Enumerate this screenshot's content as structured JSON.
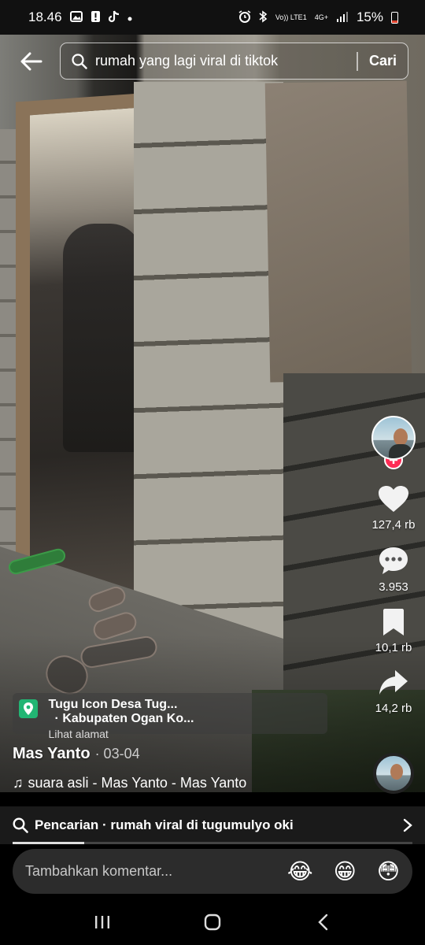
{
  "status_bar": {
    "time": "18.46",
    "left_icons": [
      "gallery-icon",
      "alert-icon",
      "tiktok-icon",
      "dot-icon"
    ],
    "right_icons": [
      "alarm-icon",
      "bluetooth-icon",
      "volte-icon",
      "4g-icon",
      "signal-icon"
    ],
    "volte_label": "Vo)) LTE1",
    "net_label": "4G+",
    "battery": "15%"
  },
  "search": {
    "query": "rumah yang lagi viral di tiktok",
    "button_label": "Cari"
  },
  "rail": {
    "like_count": "127,4 rb",
    "comment_count": "3.953",
    "bookmark_count": "10,1 rb",
    "share_count": "14,2 rb"
  },
  "location": {
    "name": "Tugu Icon Desa Tug...",
    "region": "· Kabupaten Ogan Ko...",
    "sub_label": "Lihat alamat"
  },
  "author": {
    "name": "Mas Yanto",
    "date": "· 03-04"
  },
  "music": {
    "title": "suara asli - Mas Yanto - Mas Yanto"
  },
  "related_search": {
    "text": "Pencarian · rumah viral di tugumulyo oki"
  },
  "progress": 0.18,
  "comment": {
    "placeholder": "Tambahkan komentar...",
    "emojis": [
      "😂",
      "😁",
      "😳"
    ]
  },
  "colors": {
    "follow_badge": "#fe2c55",
    "location_pin": "#22b573"
  }
}
